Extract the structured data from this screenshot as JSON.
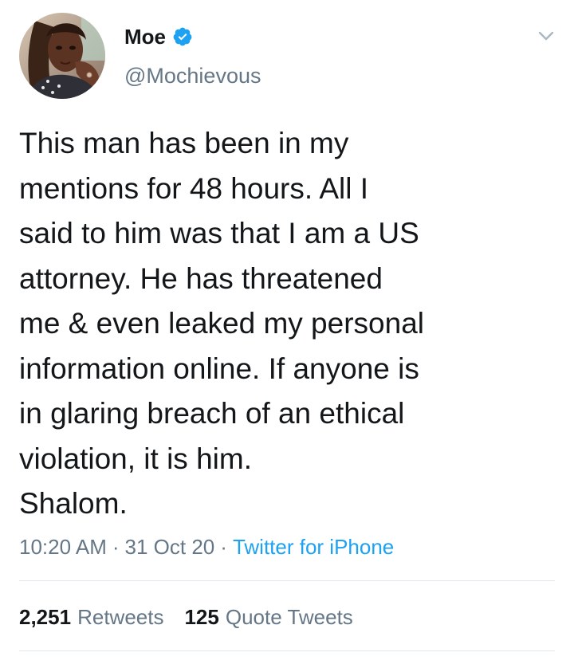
{
  "author": {
    "display_name": "Moe",
    "handle": "@Mochievous",
    "verified": true,
    "avatar_icon": "profile-photo"
  },
  "menu_icon": "chevron-down-icon",
  "tweet": {
    "lines": [
      "This man has been in my",
      "mentions for 48 hours. All I",
      "said to him was that I am a US",
      "attorney. He has threatened",
      "me & even leaked my personal",
      "information online. If anyone is",
      "in glaring breach of an ethical",
      "violation, it is him.",
      "Shalom."
    ]
  },
  "meta": {
    "time": "10:20 AM",
    "separator": "·",
    "date": "31 Oct 20",
    "source": "Twitter for iPhone"
  },
  "stats": {
    "retweets_count": "2,251",
    "retweets_label": "Retweets",
    "quotes_count": "125",
    "quotes_label": "Quote Tweets"
  },
  "colors": {
    "text": "#14171a",
    "secondary": "#657786",
    "link": "#1da1f2",
    "verified": "#1da1f2",
    "divider": "#e1e8ed"
  }
}
